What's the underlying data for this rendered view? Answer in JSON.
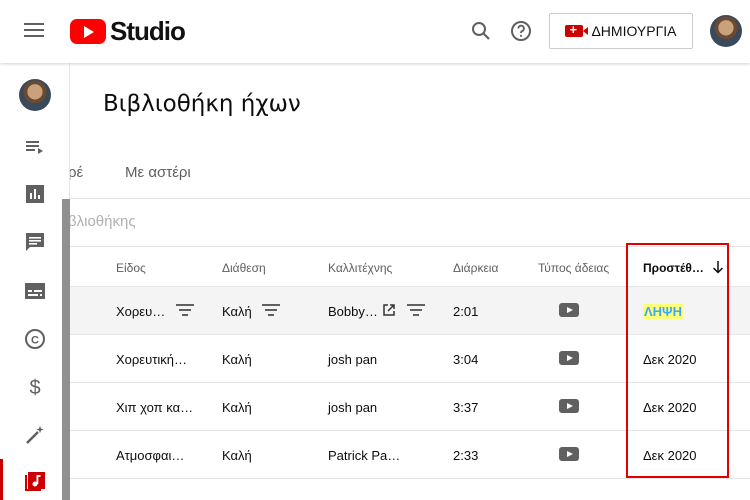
{
  "header": {
    "logo_text": "Studio",
    "create_label": "ΔΗΜΙΟΥΡΓΙΑ",
    "icons": [
      "menu-icon",
      "search-icon",
      "help-icon",
      "video-camera-add-icon"
    ]
  },
  "sidebar": {
    "icons": [
      "playlist-icon",
      "analytics-icon",
      "comments-icon",
      "subtitles-icon",
      "copyright-icon",
      "monetization-icon",
      "customization-icon",
      "audio-library-icon"
    ],
    "active_item": "audio-library-icon"
  },
  "page": {
    "title": "Βιβλιοθήκη ήχων",
    "tabs": [
      {
        "label": "ρέ"
      },
      {
        "label": "Με αστέρι"
      }
    ],
    "filter_placeholder": "βλιοθήκης"
  },
  "table": {
    "columns": [
      "Είδος",
      "Διάθεση",
      "Καλλιτέχνης",
      "Διάρκεια",
      "Τύπος άδειας",
      "Προστέθ…"
    ],
    "rows": [
      {
        "genre": "Χορευ…",
        "mood": "Καλή",
        "artist": "Bobby…",
        "duration": "2:01",
        "added": "ΛΗΨΗ"
      },
      {
        "genre": "Χορευτική…",
        "mood": "Καλή",
        "artist": "josh pan",
        "duration": "3:04",
        "added": "Δεκ 2020"
      },
      {
        "genre": "Χιπ χοπ κα…",
        "mood": "Καλή",
        "artist": "josh pan",
        "duration": "3:37",
        "added": "Δεκ 2020"
      },
      {
        "genre": "Ατμοσφαι…",
        "mood": "Καλή",
        "artist": "Patrick Pa…",
        "duration": "2:33",
        "added": "Δεκ 2020"
      }
    ]
  },
  "colors": {
    "brand_red": "#ff0000",
    "highlight_box": "#e00000",
    "download_highlight": "#fbff7a",
    "download_text": "#3ea6ff"
  }
}
